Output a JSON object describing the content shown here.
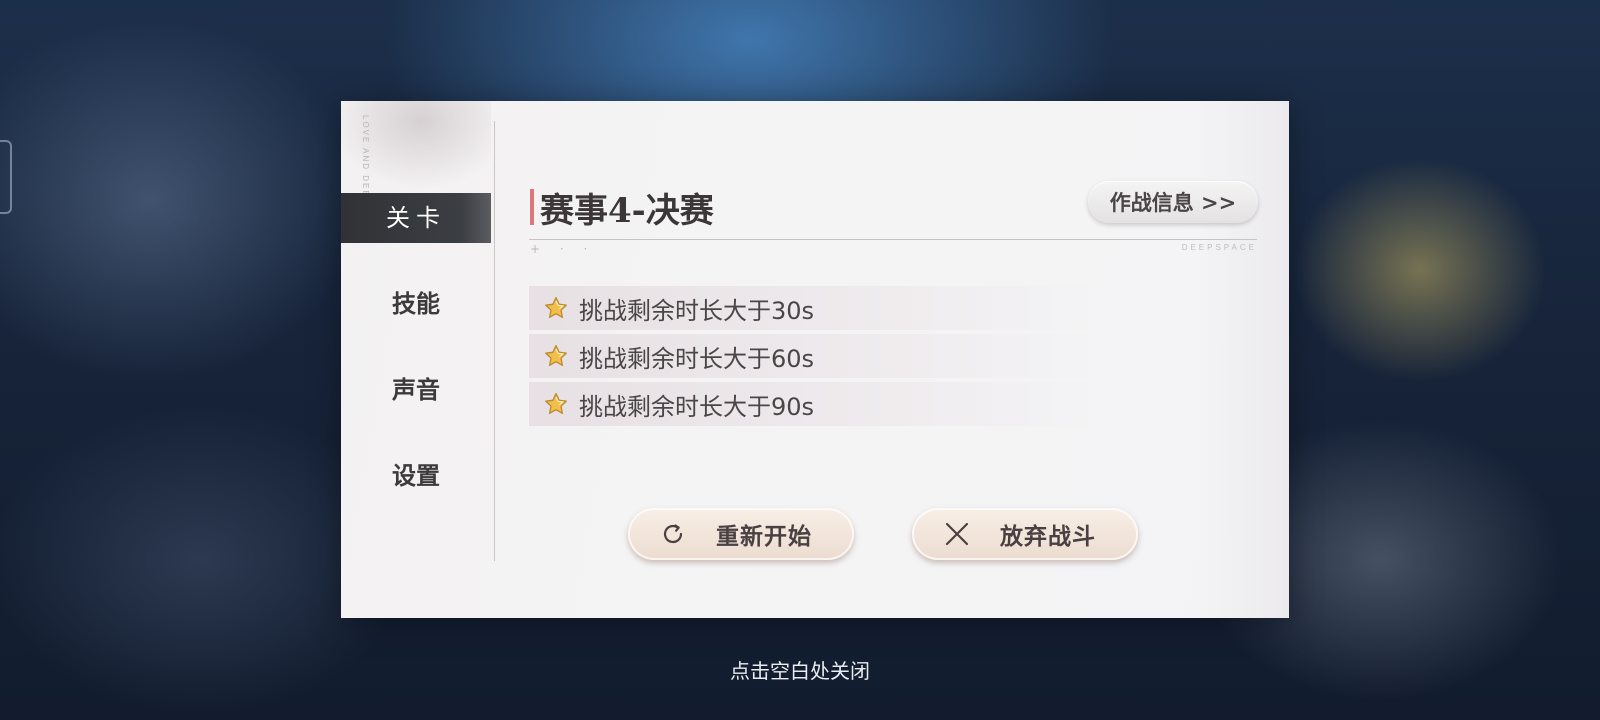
{
  "sidebar": {
    "brand_vertical": "LOVE AND DEEPSPACE",
    "items": [
      {
        "label": "关卡",
        "active": true
      },
      {
        "label": "技能",
        "active": false
      },
      {
        "label": "声音",
        "active": false
      },
      {
        "label": "设置",
        "active": false
      }
    ]
  },
  "stage": {
    "title": "赛事4-决赛",
    "battle_info_button": "作战信息 >>",
    "decor_dots": "+ · ·",
    "decor_text": "DEEPSPACE"
  },
  "goals": [
    {
      "text": "挑战剩余时长大于30s",
      "icon": "star-icon"
    },
    {
      "text": "挑战剩余时长大于60s",
      "icon": "star-icon"
    },
    {
      "text": "挑战剩余时长大于90s",
      "icon": "star-icon"
    }
  ],
  "actions": {
    "restart_label": "重新开始",
    "restart_icon": "refresh-icon",
    "abandon_label": "放弃战斗",
    "abandon_icon": "close-icon"
  },
  "footer": {
    "close_hint": "点击空白处关闭"
  },
  "colors": {
    "accent": "#d9797b",
    "active_tab_bg": "#303236",
    "button_bg": "#f3e6dc",
    "star_fill": "#f2c04a"
  }
}
